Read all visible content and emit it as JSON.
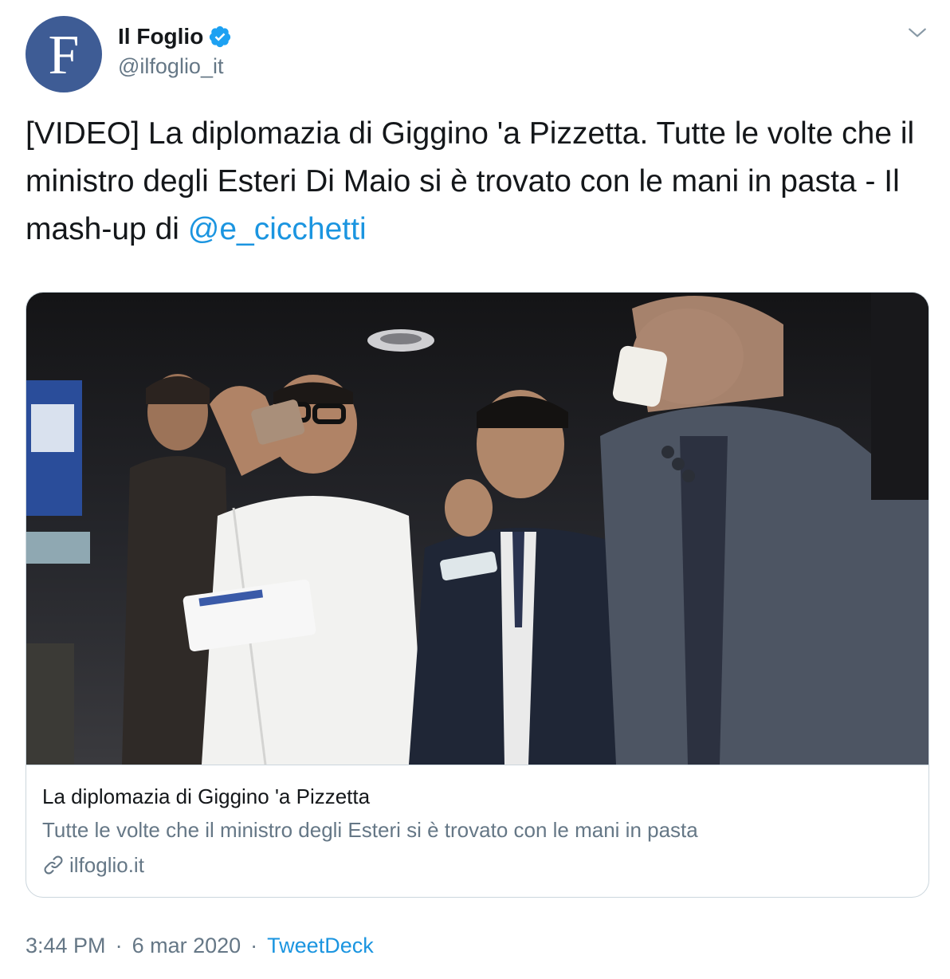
{
  "author": {
    "avatar_letter": "F",
    "display_name": "Il Foglio",
    "handle": "@ilfoglio_it",
    "verified_icon": "verified-badge-icon",
    "avatar_color": "#3e5c95"
  },
  "tweet": {
    "text_main": "[VIDEO] La diplomazia di Giggino 'a Pizzetta. Tutte le volte che il ministro degli Esteri Di Maio si è trovato con le mani in pasta - Il mash-up di ",
    "mention": "@e_cicchetti"
  },
  "card": {
    "title": "La diplomazia di Giggino 'a Pizzetta",
    "description": "Tutte le volte che il ministro degli Esteri si è trovato con le mani in pasta",
    "domain": "ilfoglio.it",
    "link_icon": "link-icon"
  },
  "meta": {
    "time": "3:44 PM",
    "separator": "·",
    "date": "6 mar 2020",
    "source": "TweetDeck"
  },
  "colors": {
    "link": "#1b95e0",
    "secondary_text": "#657786",
    "primary_text": "#14171a",
    "border": "#ccd6dd"
  }
}
